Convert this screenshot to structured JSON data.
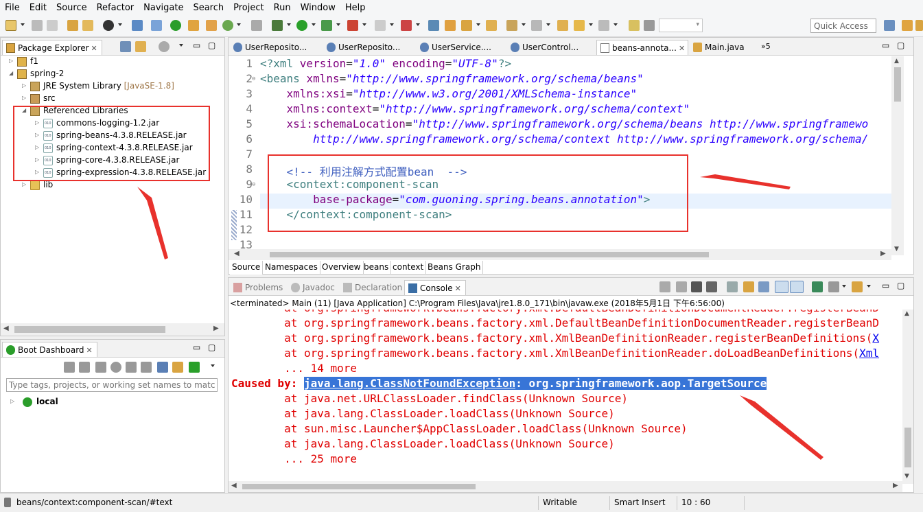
{
  "menu": [
    "File",
    "Edit",
    "Source",
    "Refactor",
    "Navigate",
    "Search",
    "Project",
    "Run",
    "Window",
    "Help"
  ],
  "toolbar": {
    "quick_access": "Quick Access"
  },
  "package_explorer": {
    "title": "Package Explorer",
    "tree": [
      {
        "label": "f1",
        "icon": "project-icon",
        "arrow": "▷"
      },
      {
        "label": "spring-2",
        "icon": "project-icon",
        "arrow": "◢"
      },
      {
        "label": "JRE System Library",
        "suffix": "[JavaSE-1.8]",
        "icon": "library-icon",
        "arrow": "▷"
      },
      {
        "label": "src",
        "icon": "source-folder-icon",
        "arrow": "▷"
      },
      {
        "label": "Referenced Libraries",
        "icon": "library-icon",
        "arrow": "◢"
      },
      {
        "label": "commons-logging-1.2.jar",
        "icon": "jar-icon",
        "arrow": "▷"
      },
      {
        "label": "spring-beans-4.3.8.RELEASE.jar",
        "icon": "jar-icon",
        "arrow": "▷"
      },
      {
        "label": "spring-context-4.3.8.RELEASE.jar",
        "icon": "jar-icon",
        "arrow": "▷"
      },
      {
        "label": "spring-core-4.3.8.RELEASE.jar",
        "icon": "jar-icon",
        "arrow": "▷"
      },
      {
        "label": "spring-expression-4.3.8.RELEASE.jar",
        "icon": "jar-icon",
        "arrow": "▷"
      },
      {
        "label": "lib",
        "icon": "folder-icon",
        "arrow": "▷"
      }
    ]
  },
  "boot_dashboard": {
    "title": "Boot Dashboard",
    "filter_placeholder": "Type tags, projects, or working set names to match",
    "items": [
      {
        "label": "local"
      }
    ]
  },
  "editor": {
    "tabs": [
      {
        "label": "UserReposito...",
        "active": false
      },
      {
        "label": "UserReposito...",
        "active": false
      },
      {
        "label": "UserService....",
        "active": false
      },
      {
        "label": "UserControl...",
        "active": false
      },
      {
        "label": "beans-annota...",
        "active": true
      },
      {
        "label": "Main.java",
        "active": false
      }
    ],
    "overflow": "»5",
    "line_numbers": [
      "1",
      "2",
      "3",
      "4",
      "5",
      "6",
      "7",
      "8",
      "9",
      "10",
      "11",
      "12",
      "13"
    ],
    "lines": {
      "l1a": "<?xml ",
      "l1b": "version",
      "l1c": "=",
      "l1d": "\"1.0\"",
      "l1e": " encoding",
      "l1f": "=",
      "l1g": "\"UTF-8\"",
      "l1h": "?>",
      "l2a": "<beans ",
      "l2b": "xmlns",
      "l2c": "=",
      "l2d": "\"http://www.springframework.org/schema/beans\"",
      "l3a": "    xmlns:xsi",
      "l3b": "=",
      "l3c": "\"http://www.w3.org/2001/XMLSchema-instance\"",
      "l4a": "    xmlns:context",
      "l4b": "=",
      "l4c": "\"http://www.springframework.org/schema/context\"",
      "l5a": "    xsi:schemaLocation",
      "l5b": "=",
      "l5c": "\"http://www.springframework.org/schema/beans http://www.springframewo",
      "l6a": "        http://www.springframework.org/schema/context http://www.springframework.org/schema/",
      "l8a": "    <!-- 利用注解方式配置bean  -->",
      "l9a": "    <context:component-scan",
      "l10a": "        base-package",
      "l10b": "=",
      "l10c": "\"com.guoning.spring.beans.annotation\"",
      "l10d": ">",
      "l11a": "    </context:component-scan>"
    },
    "bottom_tabs": [
      "Source",
      "Namespaces",
      "Overview",
      "beans",
      "context",
      "Beans Graph"
    ]
  },
  "console_panel": {
    "tabs": [
      "Problems",
      "Javadoc",
      "Declaration",
      "Console"
    ],
    "terminated": "<terminated> Main (11) [Java Application] C:\\Program Files\\Java\\jre1.8.0_171\\bin\\javaw.exe (2018年5月1日 下午6:56:00)",
    "lines": [
      "        at org.springframework.beans.factory.xml.DefaultBeanDefinitionDocumentReader.registerBeanD",
      "        at org.springframework.beans.factory.xml.XmlBeanDefinitionReader.registerBeanDefinitions(",
      "        at org.springframework.beans.factory.xml.XmlBeanDefinitionReader.doLoadBeanDefinitions(",
      "        ... 14 more",
      "        at java.net.URLClassLoader.findClass(Unknown Source)",
      "        at java.lang.ClassLoader.loadClass(Unknown Source)",
      "        at sun.misc.Launcher$AppClassLoader.loadClass(Unknown Source)",
      "        at java.lang.ClassLoader.loadClass(Unknown Source)",
      "        ... 25 more"
    ],
    "link_x": "X",
    "link_xml": "Xml",
    "caused_prefix": "Caused by: ",
    "caused_exception": "java.lang.ClassNotFoundException",
    "caused_message": ": org.springframework.aop.TargetSource"
  },
  "status": {
    "path": "beans/context:component-scan/#text",
    "writable": "Writable",
    "insert_mode": "Smart Insert",
    "position": "10 : 60"
  },
  "colors": {
    "annotation_red": "#e8312c",
    "selection_blue": "#3875d7",
    "console_error": "#e00000"
  }
}
